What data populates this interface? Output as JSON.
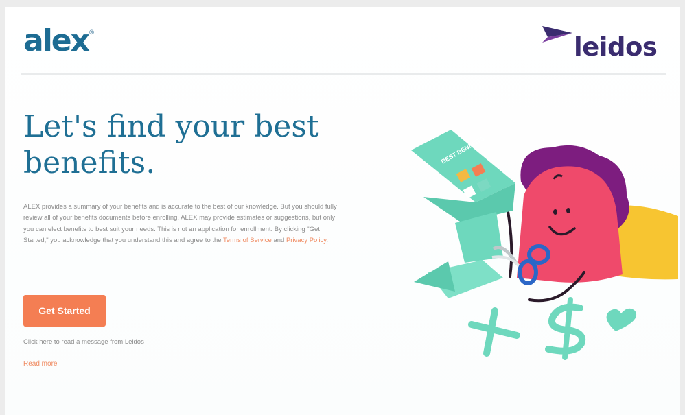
{
  "header": {
    "app_logo": "alex",
    "app_logo_mark": "®",
    "company_logo": "leidos"
  },
  "hero": {
    "headline": "Let's find your best benefits.",
    "disclaimer_text": "ALEX provides a summary of your benefits and is accurate to the best of our knowledge. But you should fully review all of your benefits documents before enrolling. ALEX may provide estimates or suggestions, but only you can elect benefits to best suit your needs. This is not an application for enrollment. By clicking \"Get Started,\" you acknowledge that you understand this and agree to the",
    "terms_link": "Terms of Service",
    "and_text": "and",
    "privacy_link": "Privacy Policy",
    "period": "."
  },
  "actions": {
    "get_started_label": "Get Started",
    "message_text": "Click here to read a message from Leidos",
    "read_more_label": "Read more"
  },
  "illustration": {
    "booklet_text": "BEST BENEFITS"
  },
  "colors": {
    "brand_blue": "#1d6c93",
    "leidos_purple": "#3a2c6f",
    "accent_orange": "#f47e53",
    "mint": "#6ed8bd",
    "character_pink": "#ef4a6b",
    "hair_purple": "#7d1d7f",
    "sun_yellow": "#f7c531"
  }
}
